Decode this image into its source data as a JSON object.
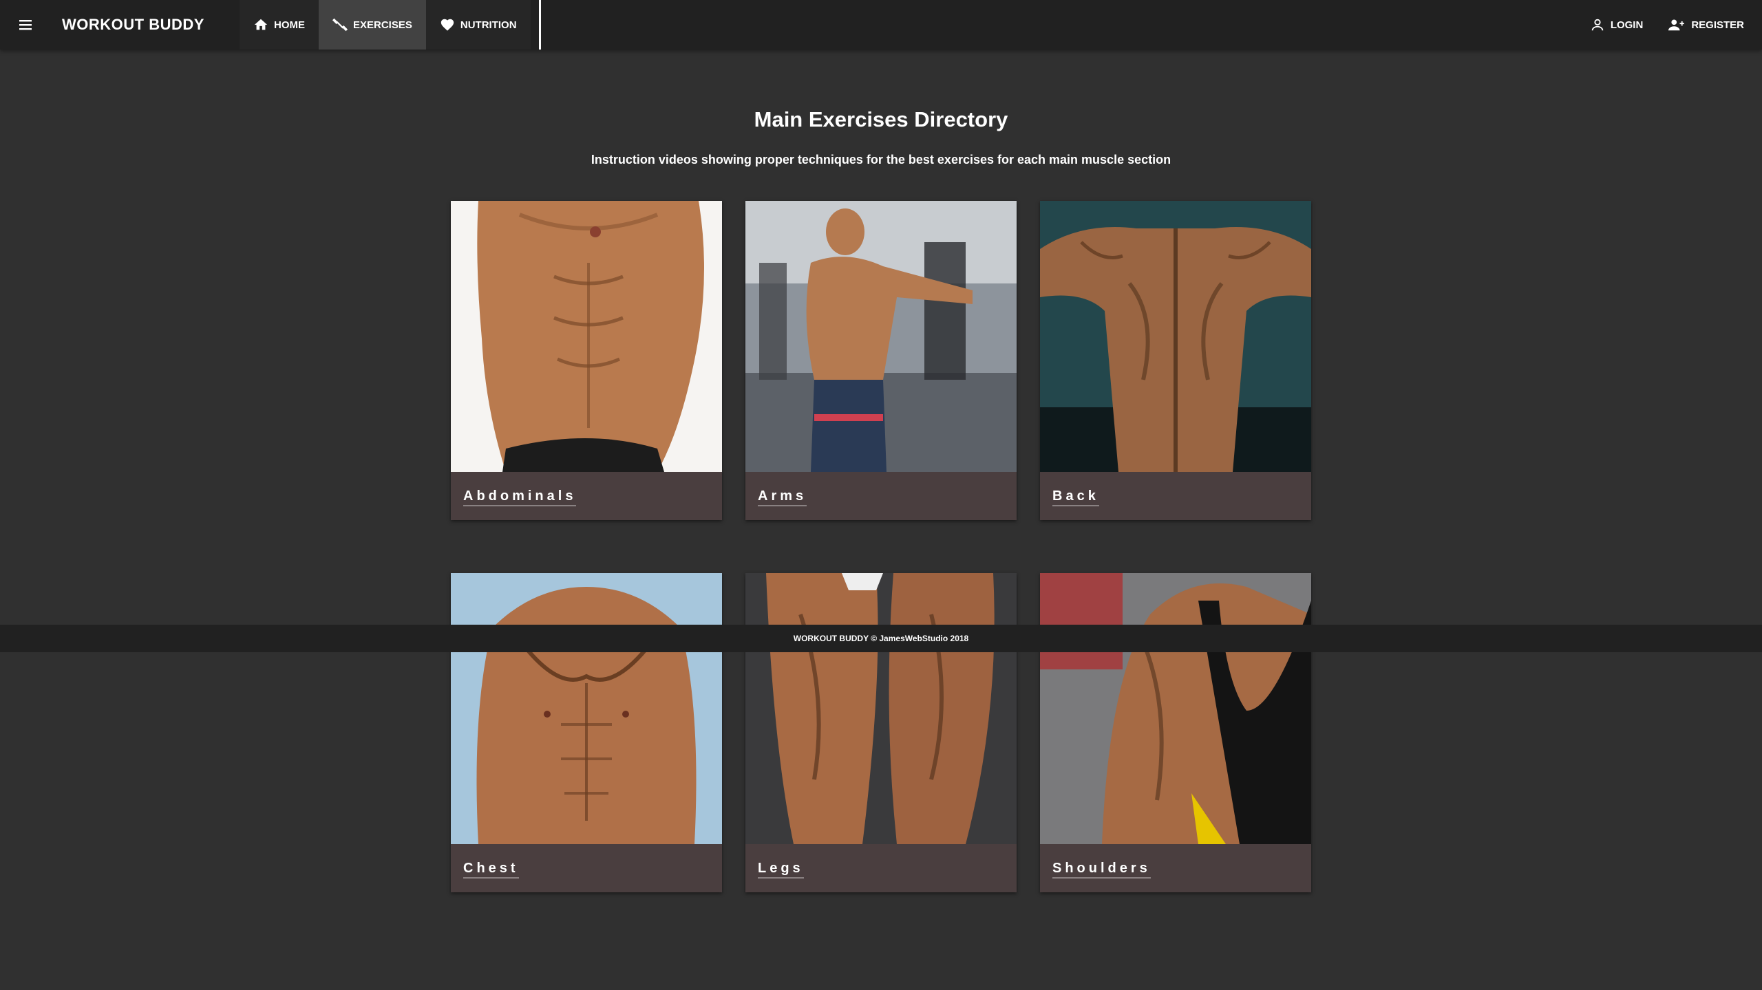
{
  "app": {
    "brand": "WORKOUT BUDDY",
    "menu_icon": "menu-icon"
  },
  "nav": {
    "tabs": [
      {
        "label": "HOME",
        "icon": "home-icon",
        "active": false
      },
      {
        "label": "EXERCISES",
        "icon": "dumbbell-icon",
        "active": true
      },
      {
        "label": "NUTRITION",
        "icon": "heart-icon",
        "active": false
      }
    ]
  },
  "auth": {
    "login_label": "LOGIN",
    "register_label": "REGISTER"
  },
  "main": {
    "title": "Main Exercises Directory",
    "subtitle": "Instruction videos showing proper techniques for the best exercises for each main muscle section",
    "cards": [
      {
        "label": "Abdominals"
      },
      {
        "label": "Arms"
      },
      {
        "label": "Back"
      },
      {
        "label": "Chest"
      },
      {
        "label": "Legs"
      },
      {
        "label": "Shoulders"
      }
    ]
  },
  "footer": {
    "text": "WORKOUT BUDDY © JamesWebStudio 2018"
  },
  "colors": {
    "page_background": "#303030",
    "app_bar": "#212121",
    "card_footer": "#4a3e3f",
    "active_tab": "#424242"
  }
}
